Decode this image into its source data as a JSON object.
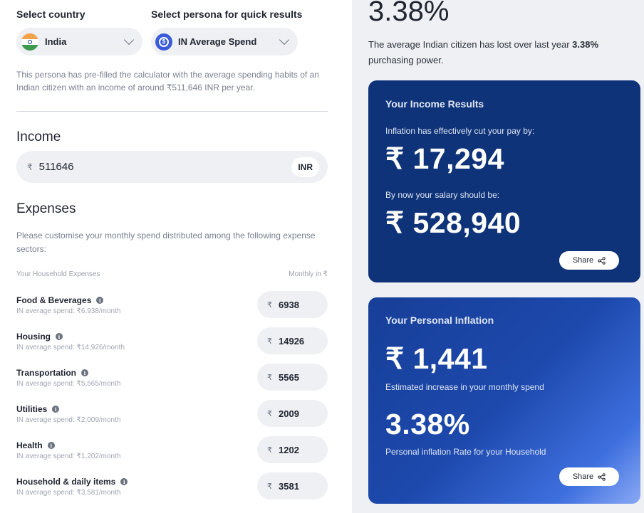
{
  "country": {
    "label": "Select country",
    "value": "India"
  },
  "persona": {
    "label": "Select persona for quick results",
    "value": "IN Average Spend"
  },
  "persona_note": "This persona has pre-filled the calculator with the average spending habits of an Indian citizen with an income of around ₹511,646 INR per year.",
  "income": {
    "heading": "Income",
    "currency_symbol": "₹",
    "value": "511646",
    "currency_code": "INR"
  },
  "expenses": {
    "heading": "Expenses",
    "note": "Please customise your monthly spend distributed among the following expense sectors:",
    "col_left": "Your Household Expenses",
    "col_right": "Monthly in ₹",
    "items": [
      {
        "name": "Food & Beverages",
        "sub": "IN average spend: ₹6,938/month",
        "value": "6938"
      },
      {
        "name": "Housing",
        "sub": "IN average spend: ₹14,926/month",
        "value": "14926"
      },
      {
        "name": "Transportation",
        "sub": "IN average spend: ₹5,565/month",
        "value": "5565"
      },
      {
        "name": "Utilities",
        "sub": "IN average spend: ₹2,009/month",
        "value": "2009"
      },
      {
        "name": "Health",
        "sub": "IN average spend: ₹1,202/month",
        "value": "1202"
      },
      {
        "name": "Household & daily items",
        "sub": "IN average spend: ₹3,581/month",
        "value": "3581"
      }
    ]
  },
  "summary": {
    "percent": "3.38%",
    "text_before": "The average Indian citizen has lost over last year ",
    "text_bold": "3.38%",
    "text_after": " purchasing power."
  },
  "income_results": {
    "title": "Your Income Results",
    "cut_label": "Inflation has effectively cut your pay by:",
    "cut_value": "₹ 17,294",
    "salary_label": "By now your salary should be:",
    "salary_value": "₹ 528,940",
    "share": "Share"
  },
  "personal_inflation": {
    "title": "Your Personal Inflation",
    "increase_value": "₹ 1,441",
    "increase_label": "Estimated increase in your monthly spend",
    "rate_value": "3.38%",
    "rate_label": "Personal inflation Rate for your Household",
    "share": "Share"
  },
  "colors": {
    "card_dark": "#0f3378",
    "card_gradient_start": "#173f98",
    "card_gradient_end": "#8aa9f5",
    "panel_bg": "#eef0f3"
  }
}
